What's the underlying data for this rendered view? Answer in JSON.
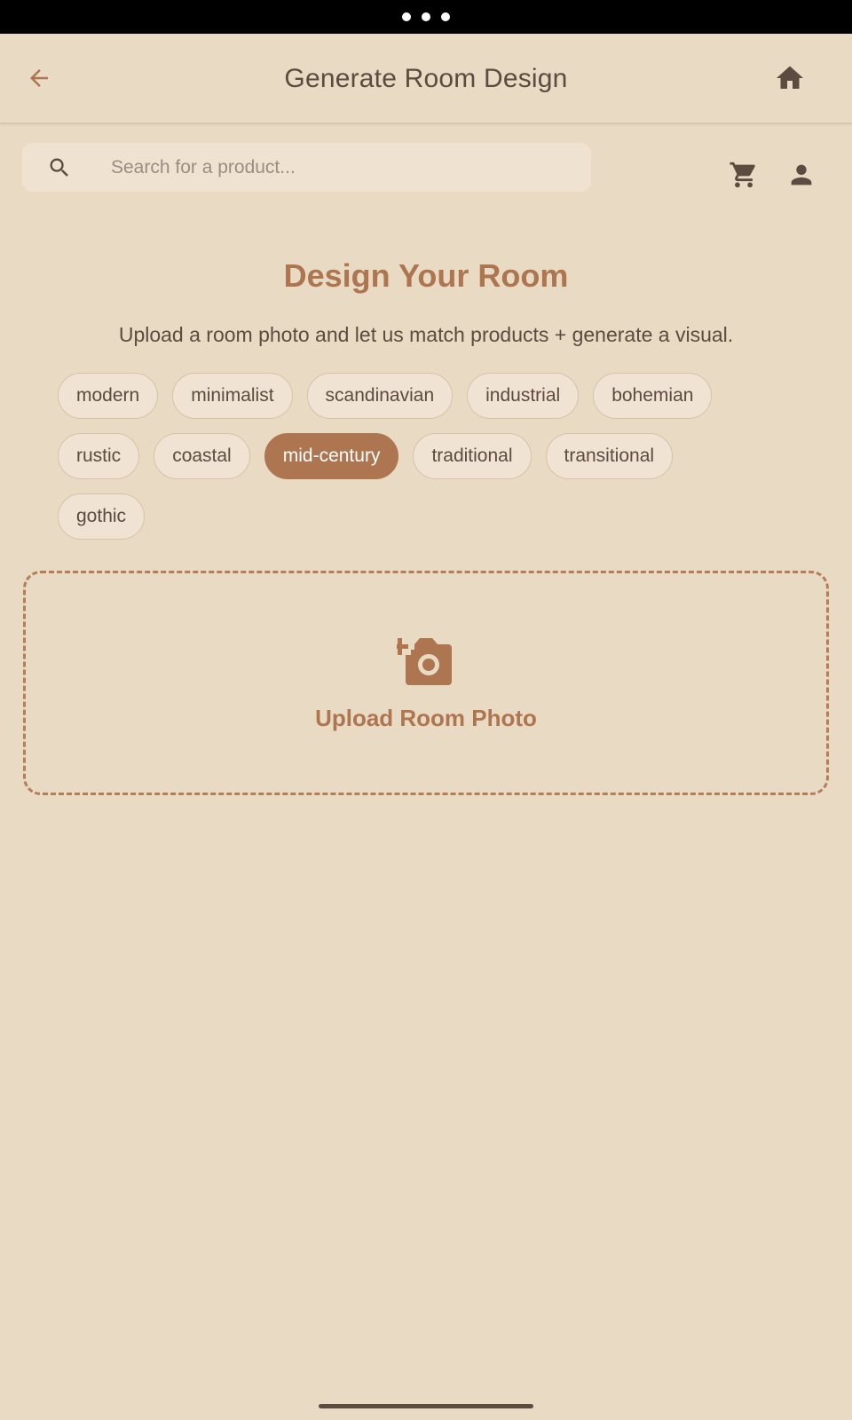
{
  "header": {
    "title": "Generate Room Design",
    "back_icon": "arrow-back-icon",
    "home_icon": "home-icon"
  },
  "search": {
    "placeholder": "Search for a product...",
    "value": ""
  },
  "actions": {
    "cart_icon": "cart-icon",
    "account_icon": "person-icon"
  },
  "main": {
    "heading": "Design Your Room",
    "subtitle": "Upload a room photo and let us match products + generate a visual.",
    "styles": [
      "modern",
      "minimalist",
      "scandinavian",
      "industrial",
      "bohemian",
      "rustic",
      "coastal",
      "mid-century",
      "traditional",
      "transitional",
      "gothic"
    ],
    "selected_style": "mid-century",
    "upload_label": "Upload Room Photo"
  },
  "colors": {
    "background": "#e9dac3",
    "accent": "#ad7651",
    "text": "#5b4b40",
    "chip_bg": "#f0e3d3"
  }
}
